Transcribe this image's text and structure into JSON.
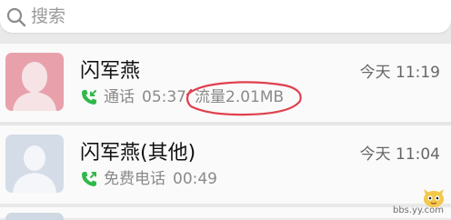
{
  "search": {
    "placeholder": "搜索",
    "icon": "search-icon"
  },
  "calls": [
    {
      "name": "闪军燕",
      "time": "今天 11:19",
      "type_label": "通话",
      "duration": "05:37",
      "traffic": "流量2.01MB",
      "call_icon": "incoming-call-icon",
      "avatar_color": "#e8a1ab",
      "icon_color": "#2fb84a",
      "annotation": "red-circle-mark"
    },
    {
      "name": "闪军燕(其他)",
      "time": "今天 11:04",
      "type_label": "免费电话",
      "duration": "00:49",
      "call_icon": "outgoing-call-icon",
      "avatar_color": "#d3dce7",
      "icon_color": "#2fb84a"
    }
  ],
  "watermark": {
    "text": "bbs.yy.com",
    "icon": "mascot-icon"
  }
}
